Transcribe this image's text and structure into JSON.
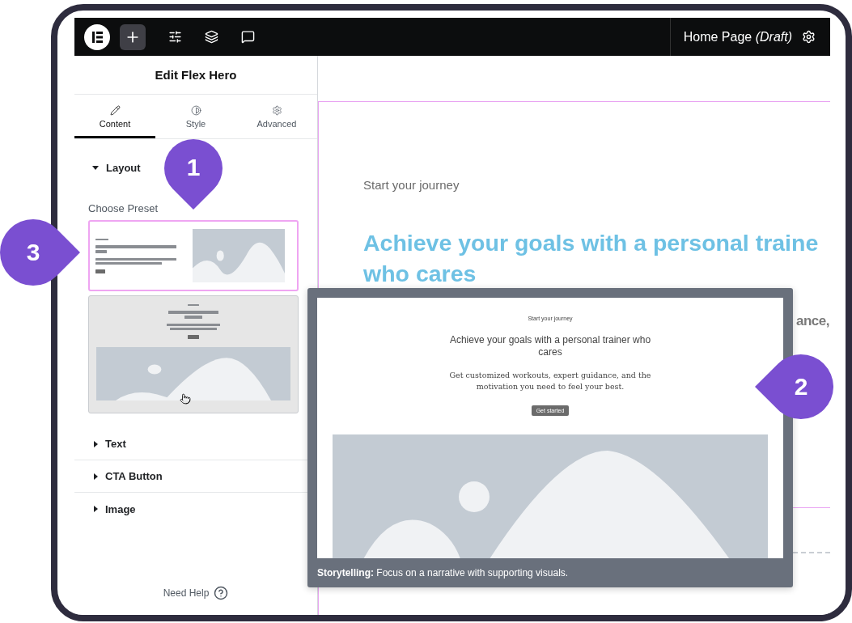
{
  "toolbar": {
    "page_title": "Home Page *(Draft)*"
  },
  "panel": {
    "title": "Edit Flex Hero",
    "tabs": [
      {
        "label": "Content",
        "selected": true
      },
      {
        "label": "Style",
        "selected": false
      },
      {
        "label": "Advanced",
        "selected": false
      }
    ],
    "sections": [
      {
        "label": "Layout",
        "expanded": true
      },
      {
        "label": "Text",
        "expanded": false
      },
      {
        "label": "CTA Button",
        "expanded": false
      },
      {
        "label": "Image",
        "expanded": false
      }
    ],
    "choose_preset": "Choose Preset",
    "presets": [
      {
        "kind": "split",
        "selected": true,
        "hovered": false
      },
      {
        "kind": "stacked",
        "selected": false,
        "hovered": true
      }
    ],
    "help": "Need Help"
  },
  "canvas": {
    "eyebrow": "Start your journey",
    "heading_lines": [
      "Achieve your goals with a personal traine",
      "who cares"
    ],
    "fragment": "ance,"
  },
  "preview": {
    "eyebrow": "Start your journey",
    "heading": "Achieve your goals with a personal trainer who cares",
    "body": "Get customized workouts, expert guidance, and the motivation you need to feel your best.",
    "button": "Get started",
    "caption": "**Storytelling:** Focus on a narrative with supporting visuals."
  },
  "markers": [
    {
      "label": "1",
      "kind": "down"
    },
    {
      "label": "2",
      "kind": "left"
    },
    {
      "label": "3",
      "kind": "right"
    }
  ]
}
